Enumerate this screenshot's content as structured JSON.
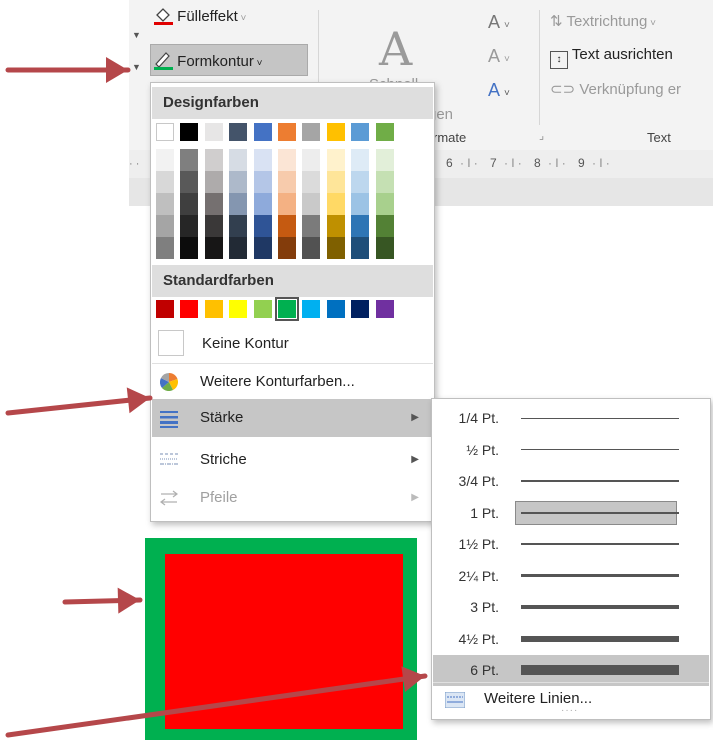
{
  "ribbon": {
    "fill_effect_label": "Fülleffekt",
    "shape_outline_label": "Formkontur",
    "text_direction_label": "Textrichtung",
    "align_text_label": "Text ausrichten",
    "link_label": "Verknüpfung er",
    "quick_styles_partial": "Schnell",
    "group_partial": "rmate",
    "group_text": "Text",
    "partial_gen": "gen",
    "ruler_numbers": [
      "6",
      "7",
      "8",
      "9"
    ]
  },
  "menu": {
    "design_colors_header": "Designfarben",
    "standard_colors_header": "Standardfarben",
    "no_outline": "Keine Kontur",
    "more_outline_colors": "Weitere Konturfarben...",
    "weight": "Stärke",
    "dashes": "Striche",
    "arrows": "Pfeile"
  },
  "theme_colors": [
    "#ffffff",
    "#000000",
    "#e7e6e6",
    "#44546a",
    "#4472c4",
    "#ed7d31",
    "#a5a5a5",
    "#ffc000",
    "#5b9bd5",
    "#70ad47"
  ],
  "theme_shades": [
    [
      "#f2f2f2",
      "#7f7f7f",
      "#d0cece",
      "#d6dce4",
      "#d9e2f3",
      "#fbe5d5",
      "#ededed",
      "#fff2cc",
      "#deebf6",
      "#e2efd9"
    ],
    [
      "#d8d8d8",
      "#595959",
      "#aeabab",
      "#adb9ca",
      "#b4c6e7",
      "#f7cbac",
      "#dbdbdb",
      "#fee599",
      "#bdd7ee",
      "#c5e0b3"
    ],
    [
      "#bfbfbf",
      "#3f3f3f",
      "#757070",
      "#8496b0",
      "#8eaadb",
      "#f4b183",
      "#c9c9c9",
      "#ffd965",
      "#9cc3e5",
      "#a8d08d"
    ],
    [
      "#a5a5a5",
      "#262626",
      "#3a3838",
      "#323f4f",
      "#2f5496",
      "#c55a11",
      "#7b7b7b",
      "#bf9000",
      "#2e75b5",
      "#538135"
    ],
    [
      "#7f7f7f",
      "#0c0c0c",
      "#171616",
      "#222a35",
      "#1f3864",
      "#833c0b",
      "#525252",
      "#7f6000",
      "#1e4e79",
      "#375623"
    ]
  ],
  "standard_colors": [
    "#c00000",
    "#ff0000",
    "#ffc000",
    "#ffff00",
    "#92d050",
    "#00b050",
    "#00b0f0",
    "#0070c0",
    "#002060",
    "#7030a0"
  ],
  "submenu": {
    "weights": [
      "1/4 Pt.",
      "½ Pt.",
      "3/4 Pt.",
      "1 Pt.",
      "1½ Pt.",
      "2¼ Pt.",
      "3 Pt.",
      "4½ Pt.",
      "6 Pt."
    ],
    "more_lines": "Weitere Linien..."
  },
  "colors": {
    "arrow": "#b5474a",
    "shape_outline": "#00b050",
    "shape_fill": "#ff0000",
    "menu_highlight": "#c6c6c6"
  }
}
